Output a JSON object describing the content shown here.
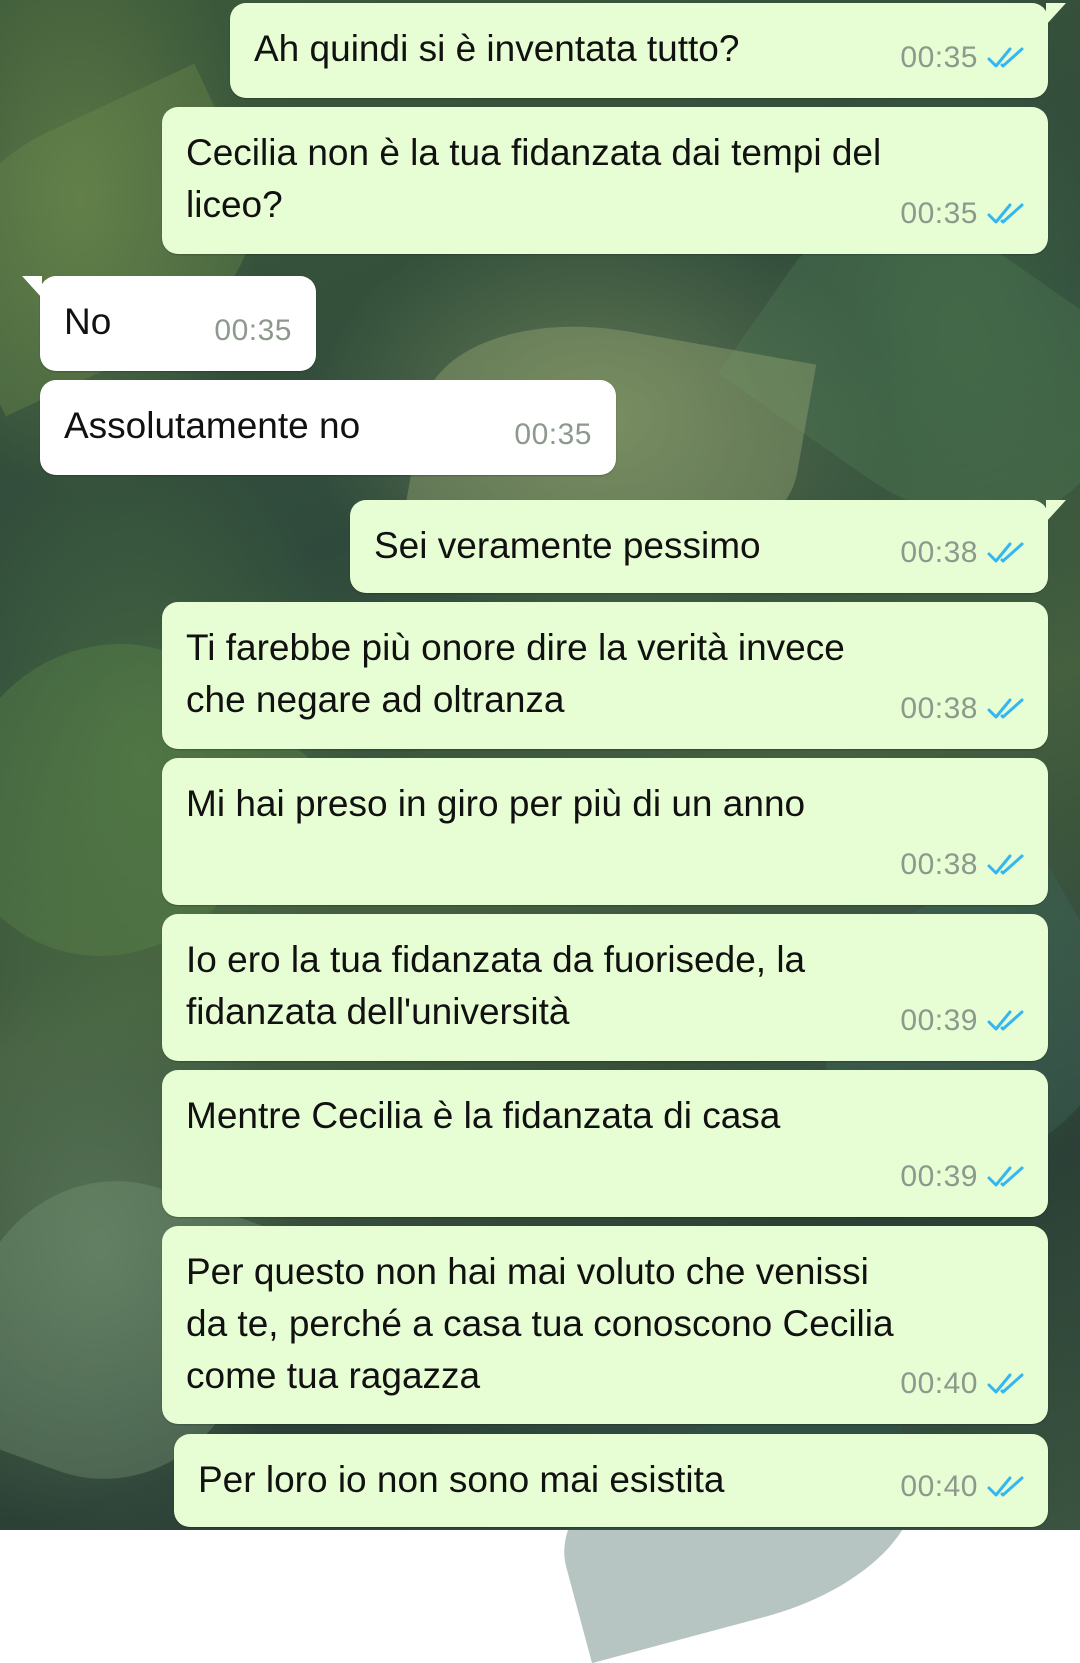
{
  "colors": {
    "outgoing_bubble": "#e7fdd3",
    "incoming_bubble": "#ffffff",
    "read_ticks": "#34b7f1",
    "timestamp": "#8c998c"
  },
  "icons": {
    "read_receipt": "double-check-icon"
  },
  "messages": [
    {
      "direction": "outgoing",
      "text": "Ah quindi si è inventata tutto?",
      "time": "00:35",
      "status": "read"
    },
    {
      "direction": "outgoing",
      "text": "Cecilia non è la tua fidanzata dai tempi del\nliceo?",
      "time": "00:35",
      "status": "read"
    },
    {
      "direction": "incoming",
      "text": "No",
      "time": "00:35"
    },
    {
      "direction": "incoming",
      "text": "Assolutamente no",
      "time": "00:35"
    },
    {
      "direction": "outgoing",
      "text": "Sei veramente pessimo",
      "time": "00:38",
      "status": "read"
    },
    {
      "direction": "outgoing",
      "text": "Ti farebbe più onore dire la verità invece\nche negare ad oltranza",
      "time": "00:38",
      "status": "read"
    },
    {
      "direction": "outgoing",
      "text": "Mi hai preso in giro per più di un anno",
      "time": "00:38",
      "status": "read"
    },
    {
      "direction": "outgoing",
      "text": "Io ero la tua fidanzata da fuorisede, la\nfidanzata dell'università",
      "time": "00:39",
      "status": "read"
    },
    {
      "direction": "outgoing",
      "text": "Mentre Cecilia è la fidanzata di casa",
      "time": "00:39",
      "status": "read"
    },
    {
      "direction": "outgoing",
      "text": "Per questo non hai mai voluto che venissi\nda te, perché a casa tua conoscono Cecilia\ncome tua ragazza",
      "time": "00:40",
      "status": "read"
    },
    {
      "direction": "outgoing",
      "text": "Per loro io non sono mai esistita",
      "time": "00:40",
      "status": "read"
    }
  ]
}
